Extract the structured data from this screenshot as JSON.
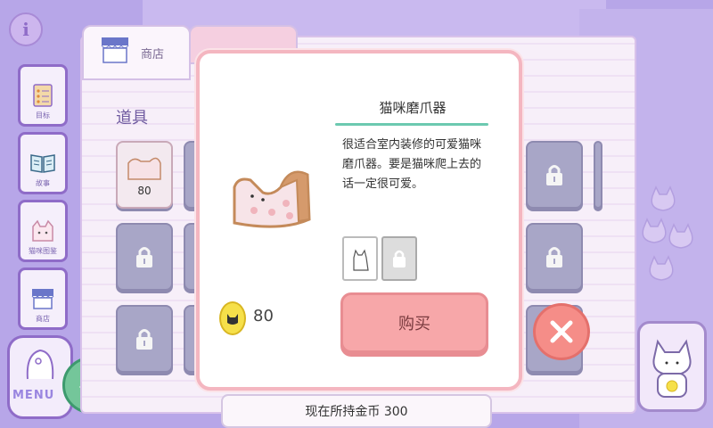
{
  "sidebar": {
    "info": "i",
    "items": [
      {
        "label": "目标"
      },
      {
        "label": "故事"
      },
      {
        "label": "猫咪图鉴"
      },
      {
        "label": "商店"
      }
    ],
    "menu_label": "MENU"
  },
  "shop": {
    "tab_label": "商店",
    "section_title": "道具",
    "first_item_count": "80"
  },
  "popup": {
    "item_name": "猫咪磨爪器",
    "description": "很适合室内装修的可爱猫咪磨爪器。要是猫咪爬上去的话一定很可爱。",
    "price": "80",
    "buy_label": "购买",
    "close_icon": "x-icon"
  },
  "footer": {
    "gold_text": "现在所持金币 300"
  },
  "colors": {
    "accent_pink": "#f7a7a9",
    "teal_line": "#6cc9b0",
    "purple": "#8f6cc8"
  }
}
